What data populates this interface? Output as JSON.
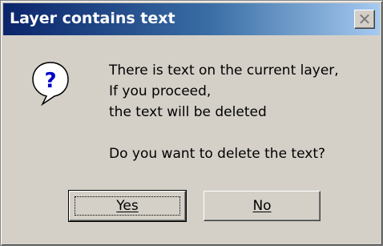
{
  "dialog": {
    "title": "Layer contains text",
    "close_icon": "close-icon",
    "icon": "question-icon",
    "message_lines": [
      "There is text on the current layer,",
      "If you proceed,",
      "the text will be deleted"
    ],
    "question": "Do you want to delete the text?",
    "buttons": {
      "yes": "Yes",
      "no": "No"
    }
  },
  "colors": {
    "title_bar_start": "#0a246a",
    "title_bar_end": "#a6caf0",
    "face": "#d4d0c8",
    "icon_blue": "#0000c8"
  }
}
